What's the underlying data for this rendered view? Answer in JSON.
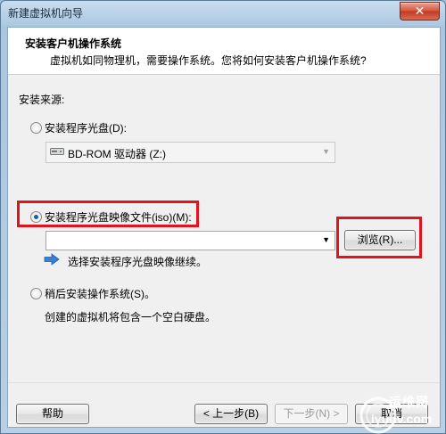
{
  "window": {
    "title": "新建虚拟机向导",
    "close_label": "✕"
  },
  "header": {
    "title": "安装客户机操作系统",
    "subtitle": "虚拟机如同物理机，需要操作系统。您将如何安装客户机操作系统?"
  },
  "source": {
    "label": "安装来源:",
    "disc": {
      "label": "安装程序光盘(D):",
      "selected": false,
      "drive": "BD-ROM 驱动器 (Z:)"
    },
    "iso": {
      "label": "安装程序光盘映像文件(iso)(M):",
      "selected": true,
      "path_value": "",
      "browse_label": "浏览(R)...",
      "hint": "选择安装程序光盘映像继续。"
    },
    "later": {
      "label": "稍后安装操作系统(S)。",
      "desc": "创建的虚拟机将包含一个空白硬盘。"
    }
  },
  "buttons": {
    "help": "帮助",
    "back": "< 上一步(B)",
    "next": "下一步(N) >",
    "cancel": "取消"
  },
  "watermark": {
    "text_cn": "运维网",
    "text_en": "iyunv.com"
  },
  "colors": {
    "highlight_box": "#e0141c",
    "accent": "#1f5e9e"
  }
}
